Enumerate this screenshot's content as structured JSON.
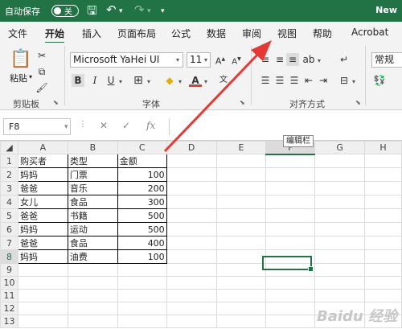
{
  "titlebar": {
    "autosave_label": "自动保存",
    "autosave_state": "关",
    "doc_name": "New"
  },
  "tabs": [
    "文件",
    "开始",
    "插入",
    "页面布局",
    "公式",
    "数据",
    "审阅",
    "视图",
    "帮助",
    "Acrobat"
  ],
  "ribbon": {
    "paste_label": "粘贴",
    "clipboard_label": "剪贴板",
    "font_name": "Microsoft YaHei UI",
    "font_size": "11",
    "font_group_label": "字体",
    "align_group_label": "对齐方式",
    "number_format": "常规",
    "bold": "B",
    "italic": "I",
    "underline": "U"
  },
  "formula_bar": {
    "name_box": "F8",
    "formula": "",
    "tooltip": "编辑栏"
  },
  "sheet": {
    "columns": [
      "A",
      "B",
      "C",
      "D",
      "E",
      "F",
      "G",
      "H"
    ],
    "rows": [
      [
        "购买者",
        "类型",
        "金额"
      ],
      [
        "妈妈",
        "门票",
        "100"
      ],
      [
        "爸爸",
        "音乐",
        "200"
      ],
      [
        "女儿",
        "食品",
        "300"
      ],
      [
        "爸爸",
        "书籍",
        "500"
      ],
      [
        "妈妈",
        "运动",
        "500"
      ],
      [
        "爸爸",
        "食品",
        "400"
      ],
      [
        "妈妈",
        "油费",
        "100"
      ]
    ],
    "row_numbers": [
      "1",
      "2",
      "3",
      "4",
      "5",
      "6",
      "7",
      "8",
      "9",
      "10",
      "11",
      "12",
      "13"
    ],
    "selected_cell": "F8"
  },
  "colors": {
    "accent": "#217346",
    "arrow": "#e53935"
  }
}
